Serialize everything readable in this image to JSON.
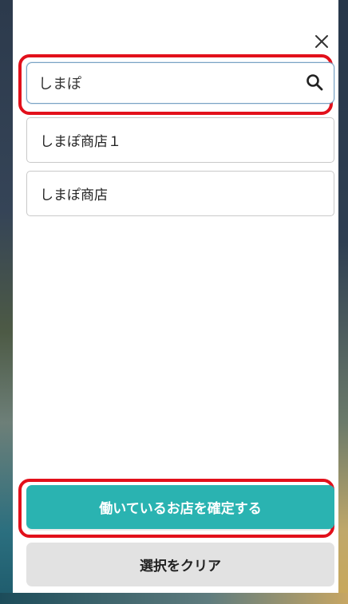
{
  "search": {
    "value": "しまぽ",
    "icon": "search-icon"
  },
  "results": [
    {
      "label": "しまぽ商店１"
    },
    {
      "label": "しまぽ商店"
    }
  ],
  "buttons": {
    "confirm_label": "働いているお店を確定する",
    "clear_label": "選択をクリア",
    "close_icon": "close-icon"
  },
  "colors": {
    "accent": "#2ab3b1",
    "highlight": "#e2101b",
    "secondary_button": "#e2e2e2"
  }
}
